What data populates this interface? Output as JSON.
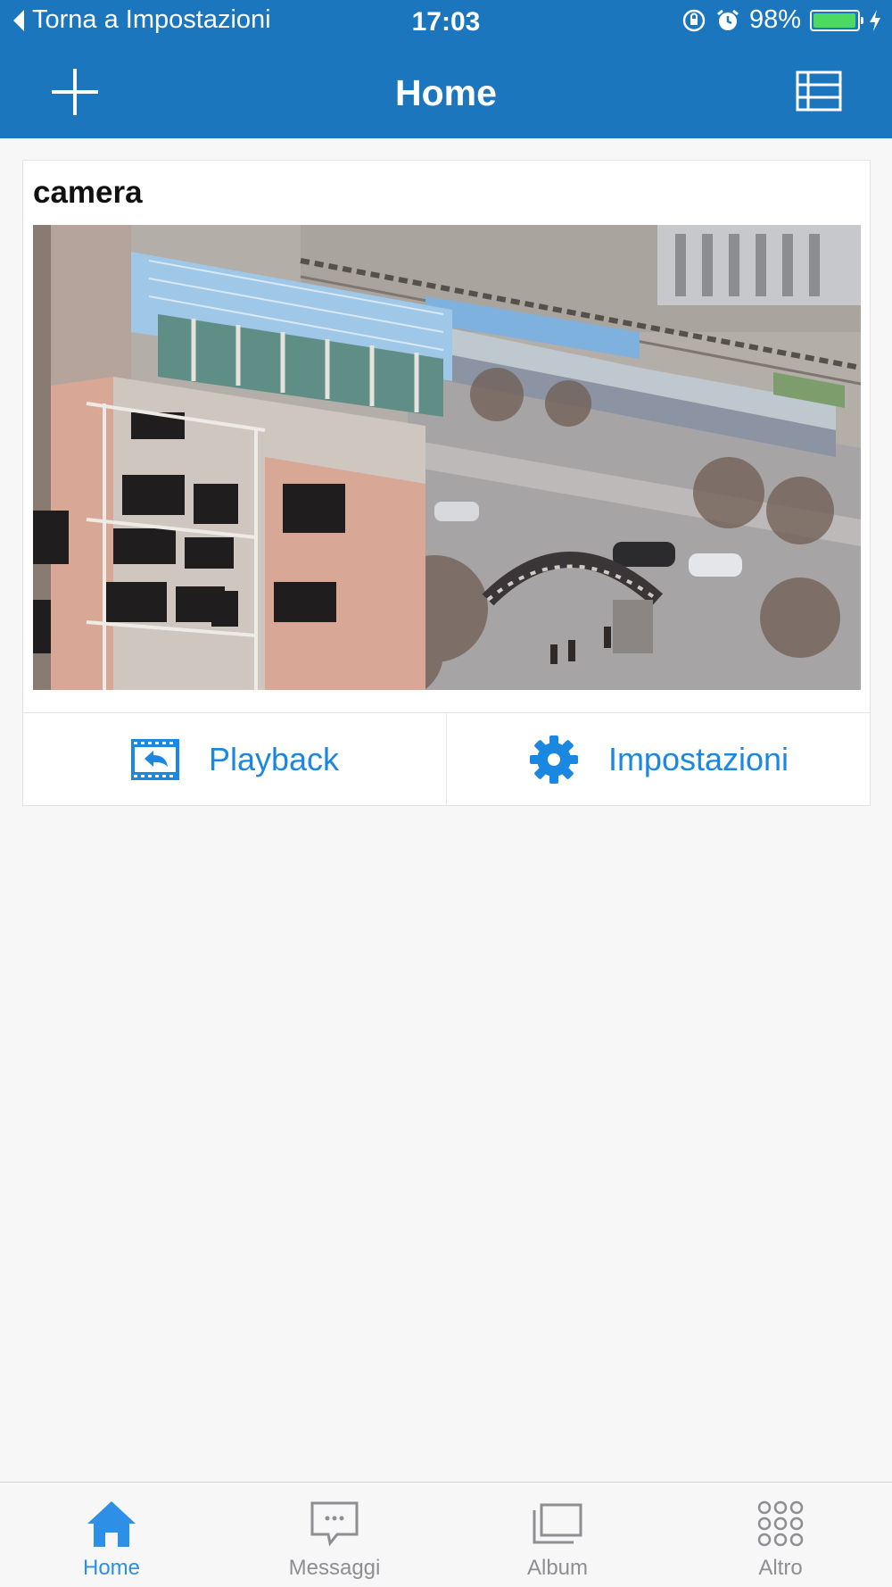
{
  "status_bar": {
    "back_label": "Torna a Impostazioni",
    "time": "17:03",
    "battery_percent": "98%",
    "battery_level": 0.98
  },
  "nav": {
    "title": "Home",
    "left_icon": "plus-icon",
    "right_icon": "list-view-icon"
  },
  "device": {
    "name": "camera",
    "actions": [
      {
        "label": "Playback",
        "icon": "playback-icon"
      },
      {
        "label": "Impostazioni",
        "icon": "gear-icon"
      }
    ]
  },
  "tabbar": {
    "tabs": [
      {
        "label": "Home",
        "icon": "home-icon",
        "active": true
      },
      {
        "label": "Messaggi",
        "icon": "message-icon",
        "active": false
      },
      {
        "label": "Album",
        "icon": "album-icon",
        "active": false
      },
      {
        "label": "Altro",
        "icon": "more-grid-icon",
        "active": false
      }
    ]
  },
  "colors": {
    "header": "#1b76bd",
    "accent": "#1a87e0",
    "tab_active": "#2d8fe6",
    "tab_inactive": "#8e8e93",
    "battery": "#4cd964"
  }
}
